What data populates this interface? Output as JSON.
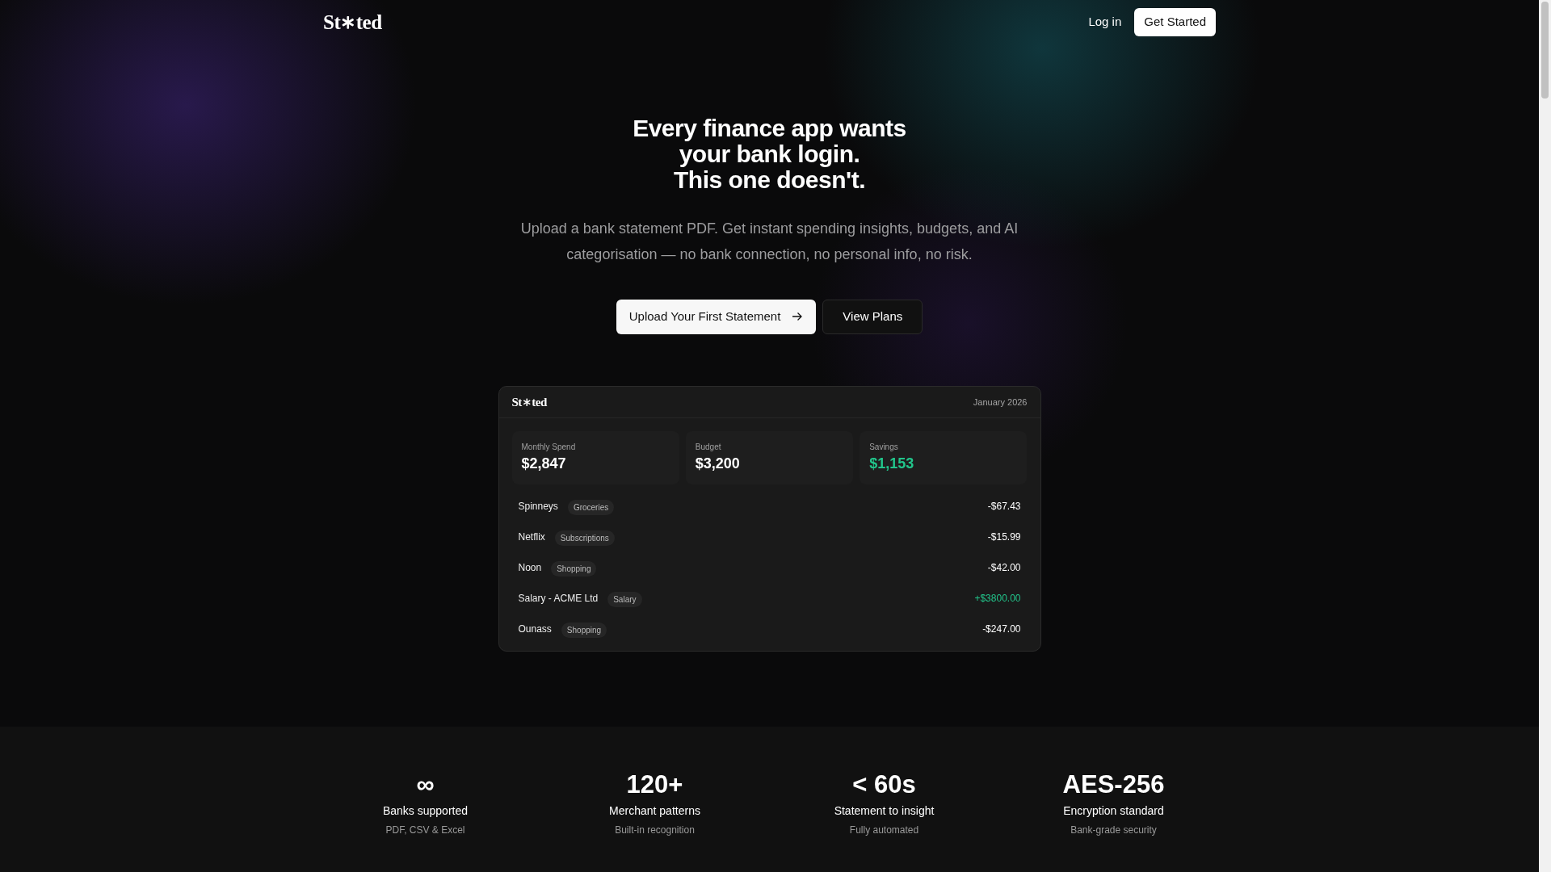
{
  "nav": {
    "logo": [
      "St",
      "ted"
    ],
    "login": "Log in",
    "cta": "Get Started"
  },
  "hero": {
    "headline": [
      "Every finance app wants",
      "your bank login.",
      "This one doesn't."
    ],
    "subtitle": "Upload a bank statement PDF. Get instant spending insights, budgets, and AI categorisation — no bank connection, no personal info, no risk.",
    "primary": "Upload Your First Statement",
    "secondary": "View Plans"
  },
  "preview": {
    "logo": [
      "St",
      "ted"
    ],
    "month": "January 2026",
    "metrics": [
      {
        "label": "Monthly Spend",
        "value": "$2,847",
        "positive": false
      },
      {
        "label": "Budget",
        "value": "$3,200",
        "positive": false
      },
      {
        "label": "Savings",
        "value": "$1,153",
        "positive": true
      }
    ],
    "transactions": [
      {
        "merchant": "Spinneys",
        "category": "Groceries",
        "amount": "-$67.43",
        "positive": false
      },
      {
        "merchant": "Netflix",
        "category": "Subscriptions",
        "amount": "-$15.99",
        "positive": false
      },
      {
        "merchant": "Noon",
        "category": "Shopping",
        "amount": "-$42.00",
        "positive": false
      },
      {
        "merchant": "Salary - ACME Ltd",
        "category": "Salary",
        "amount": "+$3800.00",
        "positive": true
      },
      {
        "merchant": "Ounass",
        "category": "Shopping",
        "amount": "-$247.00",
        "positive": false
      }
    ]
  },
  "stats": [
    {
      "value": "∞",
      "label": "Banks supported",
      "detail": "PDF, CSV & Excel"
    },
    {
      "value": "120+",
      "label": "Merchant patterns",
      "detail": "Built-in recognition"
    },
    {
      "value": "< 60s",
      "label": "Statement to insight",
      "detail": "Fully automated"
    },
    {
      "value": "AES-256",
      "label": "Encryption standard",
      "detail": "Bank-grade security"
    }
  ]
}
